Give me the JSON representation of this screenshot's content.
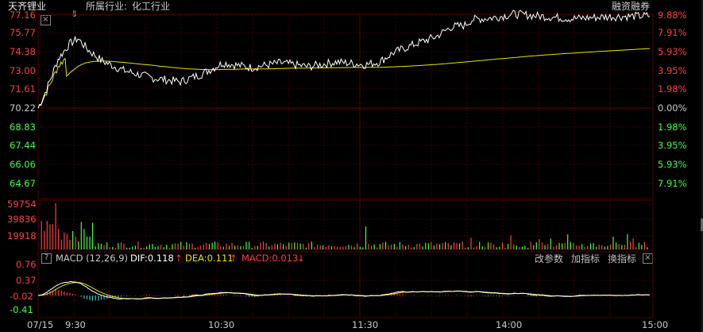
{
  "header": {
    "stock_name": "天齐锂业",
    "industry_label": "所属行业:",
    "industry_value": "化工行业",
    "margin_badge": "融资融券"
  },
  "price_axis": {
    "left": [
      "77.16",
      "75.77",
      "74.38",
      "73.00",
      "71.61",
      "70.22",
      "68.83",
      "67.44",
      "66.06",
      "64.67"
    ],
    "right": [
      "9.88%",
      "7.91%",
      "5.93%",
      "3.95%",
      "1.98%",
      "0.00%",
      "1.98%",
      "3.95%",
      "5.93%",
      "7.91%"
    ]
  },
  "volume_axis": {
    "left": [
      "59754",
      "39836",
      "19918"
    ]
  },
  "macd": {
    "help_label": "?",
    "title": "MACD (12,26,9)",
    "dif": "DIF:0.118",
    "dif_arrow": "↑",
    "dea": "DEA:0.111",
    "dea_arrow": "↑",
    "macd_value": "MACD:0.013",
    "macd_arrow": "↓",
    "axis": [
      "0.76",
      "0.37",
      "-0.02",
      "-0.41"
    ],
    "tools": [
      "改参数",
      "加指标",
      "换指标"
    ]
  },
  "time_axis": [
    "07/15",
    "9:30",
    "10:30",
    "11:30",
    "14:00",
    "15:00"
  ],
  "colors": {
    "up": "#ff4040",
    "down": "#40ff40",
    "price_line": "#ffffff",
    "avg_line": "#e6e600",
    "dif_line": "#ffffff",
    "dea_line": "#e6e600",
    "macd_neg": "#40c0c0",
    "grid": "#3c0000"
  },
  "icons": [
    "close-icon",
    "down-arrow-icon"
  ]
}
